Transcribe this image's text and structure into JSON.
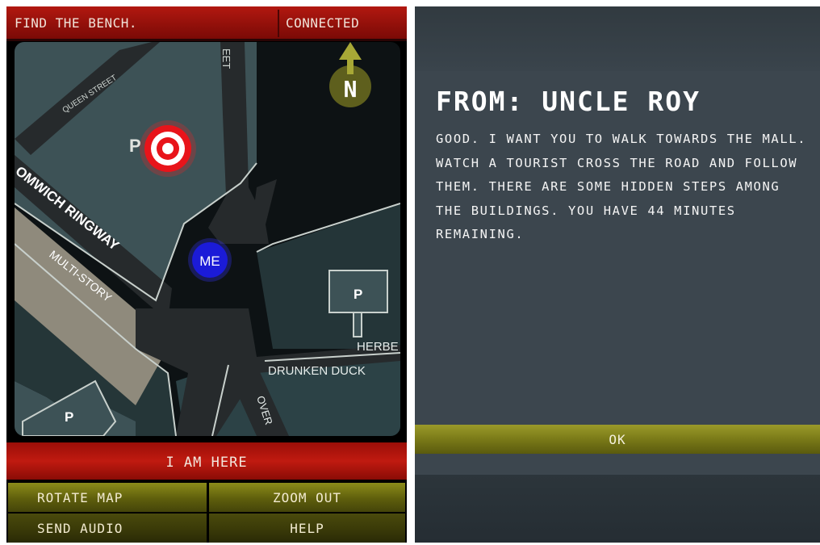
{
  "left_screen": {
    "status_left": "FIND THE BENCH.",
    "status_right": "CONNECTED",
    "map": {
      "compass_letter": "N",
      "me_label": "ME",
      "streets": [
        "QUEEN STREET",
        "EET",
        "OMWICH RINGWAY",
        "HERBE",
        "OVER"
      ],
      "buildings": [
        "MULTI-STORY",
        "DRUNKEN DUCK"
      ],
      "parking_label": "P"
    },
    "primary_button": "I AM HERE",
    "buttons": [
      "ROTATE MAP",
      "ZOOM OUT",
      "SEND AUDIO",
      "HELP"
    ]
  },
  "right_screen": {
    "title": "FROM: UNCLE ROY",
    "message": "GOOD. I WANT YOU TO WALK TOWARDS THE MALL. WATCH A TOURIST CROSS THE ROAD AND FOLLOW THEM. THERE ARE SOME HIDDEN STEPS AMONG THE BUILDINGS. YOU HAVE 44 MINUTES REMAINING.",
    "ok_button": "OK"
  },
  "colors": {
    "top_bar": "#b21810",
    "map_block": "#3d5256",
    "map_road": "#262a2c",
    "olive_button": "#7a7a18",
    "dialog_bg": "#3c464e"
  }
}
